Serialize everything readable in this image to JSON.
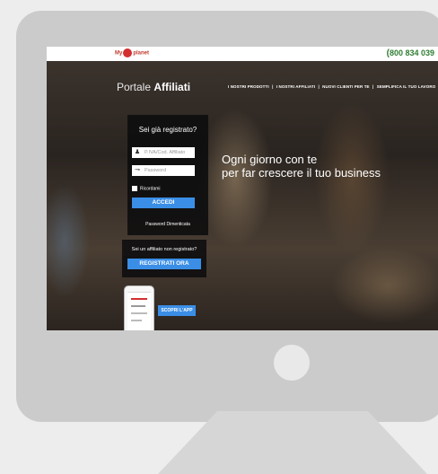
{
  "header": {
    "logo_text": "My",
    "logo_dot_text": "planet",
    "phone_icon": "phone-icon",
    "phone": "800 834 039"
  },
  "portal": {
    "title_light": "Portale",
    "title_bold": "Affiliati"
  },
  "nav": {
    "items": [
      "I NOSTRI PRODOTTI",
      "I NOSTRI AFFILIATI",
      "NUOVI CLIENTI PER TE",
      "SEMPLIFICA IL TUO LAVORO"
    ],
    "separator": "|"
  },
  "login": {
    "title": "Sei già registrato?",
    "user_placeholder": "P.IVA/Cod. Affiliato",
    "password_placeholder": "Password",
    "remember_label": "Ricordami",
    "submit_label": "ACCEDI",
    "forgot_label": "Password Dimenticata"
  },
  "register": {
    "question": "Sei un affiliato non registrato?",
    "button_label": "REGISTRATI ORA"
  },
  "app": {
    "button_label": "SCOPRI L'APP"
  },
  "hero": {
    "line1": "Ogni giorno con te",
    "line2": "per far crescere il tuo business"
  },
  "colors": {
    "accent_blue": "#3a8ee6",
    "brand_red": "#d32f2f",
    "phone_green": "#2e7d32",
    "monitor_frame": "#cbcbcb"
  }
}
